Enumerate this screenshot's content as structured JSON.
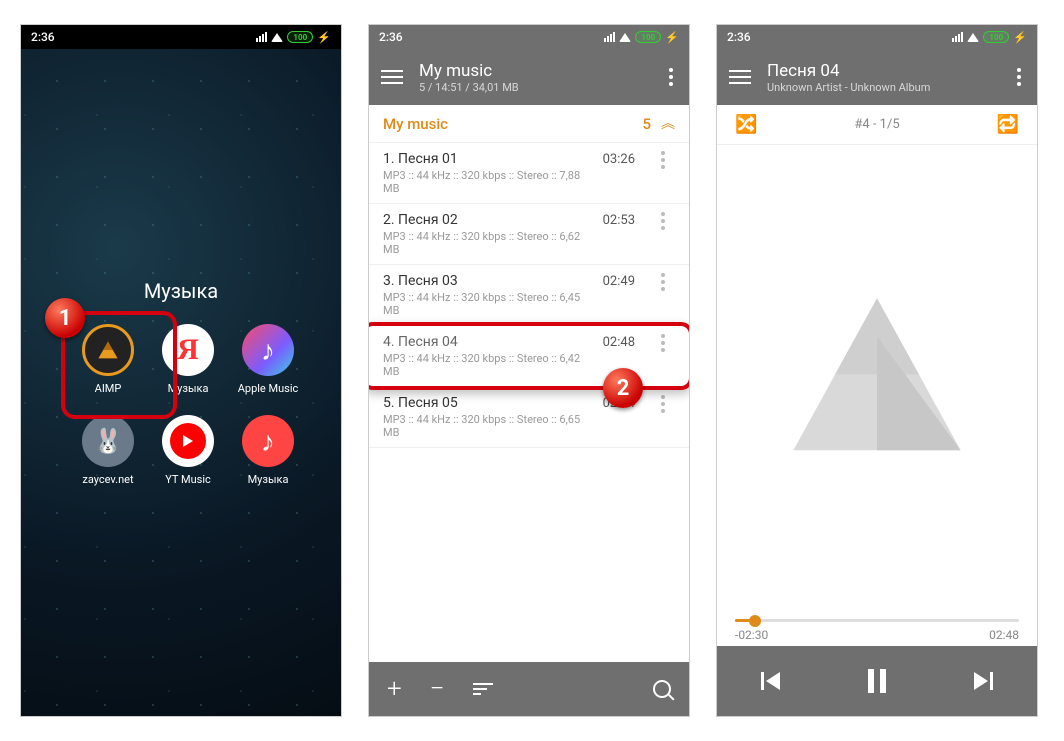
{
  "status": {
    "time": "2:36",
    "battery": "100"
  },
  "phone1": {
    "folder_title": "Музыка",
    "apps": [
      {
        "name": "AIMP",
        "icon": "aimp"
      },
      {
        "name": "Музыка",
        "icon": "yandex"
      },
      {
        "name": "Apple Music",
        "icon": "apple"
      },
      {
        "name": "zaycev.net",
        "icon": "zaycev"
      },
      {
        "name": "YT Music",
        "icon": "yt"
      },
      {
        "name": "Музыка",
        "icon": "miu"
      }
    ],
    "badge": "1"
  },
  "phone2": {
    "title": "My music",
    "subtitle": "5 / 14:51 / 34,01 MB",
    "section_name": "My music",
    "section_count": "5",
    "tracks": [
      {
        "title": "1. Песня 01",
        "meta": "MP3 :: 44 kHz :: 320 kbps :: Stereo :: 7,88 MB",
        "dur": "03:26"
      },
      {
        "title": "2. Песня 02",
        "meta": "MP3 :: 44 kHz :: 320 kbps :: Stereo :: 6,62 MB",
        "dur": "02:53"
      },
      {
        "title": "3. Песня 03",
        "meta": "MP3 :: 44 kHz :: 320 kbps :: Stereo :: 6,45 MB",
        "dur": "02:49"
      },
      {
        "title": "4. Песня 04",
        "meta": "MP3 :: 44 kHz :: 320 kbps :: Stereo :: 6,42 MB",
        "dur": "02:48"
      },
      {
        "title": "5. Песня 05",
        "meta": "MP3 :: 44 kHz :: 320 kbps :: Stereo :: 6,65 MB",
        "dur": "02:54"
      }
    ],
    "selected_index": 3,
    "badge": "2"
  },
  "phone3": {
    "title": "Песня 04",
    "subtitle": "Unknown Artist - Unknown Album",
    "queue": "#4   -   1/5",
    "elapsed_neg": "-02:30",
    "total": "02:48"
  }
}
